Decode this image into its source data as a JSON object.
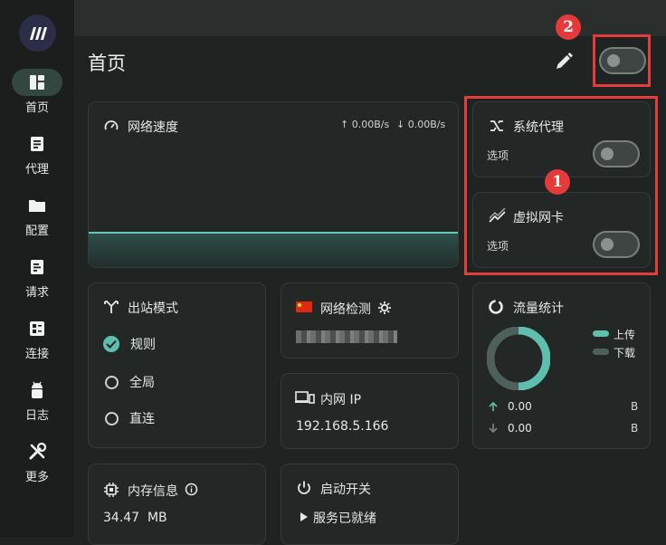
{
  "sidebar": {
    "items": [
      {
        "label": "首页",
        "icon": "dashboard-icon",
        "active": true
      },
      {
        "label": "代理",
        "icon": "proxy-list-icon",
        "active": false
      },
      {
        "label": "配置",
        "icon": "folder-icon",
        "active": false
      },
      {
        "label": "请求",
        "icon": "requests-icon",
        "active": false
      },
      {
        "label": "连接",
        "icon": "connections-icon",
        "active": false
      },
      {
        "label": "日志",
        "icon": "android-icon",
        "active": false
      },
      {
        "label": "更多",
        "icon": "tools-icon",
        "active": false
      }
    ]
  },
  "header": {
    "title": "首页"
  },
  "speed": {
    "title": "网络速度",
    "up": "↑ 0.00B/s",
    "down": "↓ 0.00B/s"
  },
  "system_proxy": {
    "title": "系统代理",
    "option": "选项"
  },
  "virtual_nic": {
    "title": "虚拟网卡",
    "option": "选项"
  },
  "outbound": {
    "title": "出站模式",
    "options": [
      "规则",
      "全局",
      "直连"
    ],
    "selected": "规则"
  },
  "net_check": {
    "title": "网络检测"
  },
  "lan_ip": {
    "title": "内网 IP",
    "value": "192.168.5.166"
  },
  "traffic": {
    "title": "流量统计",
    "legend_up": "上传",
    "legend_down": "下载",
    "up_value": "0.00",
    "up_unit": "B",
    "down_value": "0.00",
    "down_unit": "B"
  },
  "memory": {
    "title": "内存信息",
    "value": "34.47  MB"
  },
  "startup": {
    "title": "启动开关",
    "status": "服务已就绪"
  },
  "annotations": {
    "badge1": "1",
    "badge2": "2"
  },
  "colors": {
    "accent": "#5fbfae",
    "annotation": "#e63c3c"
  }
}
